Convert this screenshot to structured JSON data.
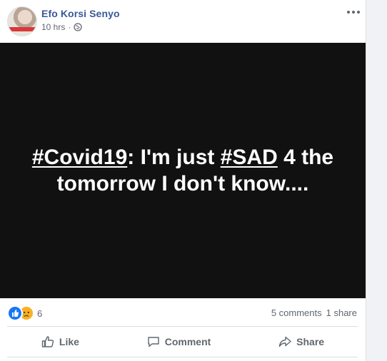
{
  "post": {
    "author": "Efo Korsi Senyo",
    "time": "10 hrs",
    "separator": "·",
    "privacy_icon": "globe-icon",
    "status": {
      "tag1": "#Covid19",
      "text1": ": I'm just ",
      "tag2": "#SAD",
      "text2": " 4 the tomorrow I don't know....",
      "background": "#111111"
    }
  },
  "reactions": {
    "icons": [
      "like-icon",
      "sad-icon"
    ],
    "count": "6",
    "comments": "5 comments",
    "shares": "1 share"
  },
  "actions": {
    "like": "Like",
    "comment": "Comment",
    "share": "Share"
  },
  "colors": {
    "author_link": "#385898",
    "meta_text": "#606770",
    "like_blue": "#1877f2",
    "sad_yellow": "#f7b125"
  }
}
